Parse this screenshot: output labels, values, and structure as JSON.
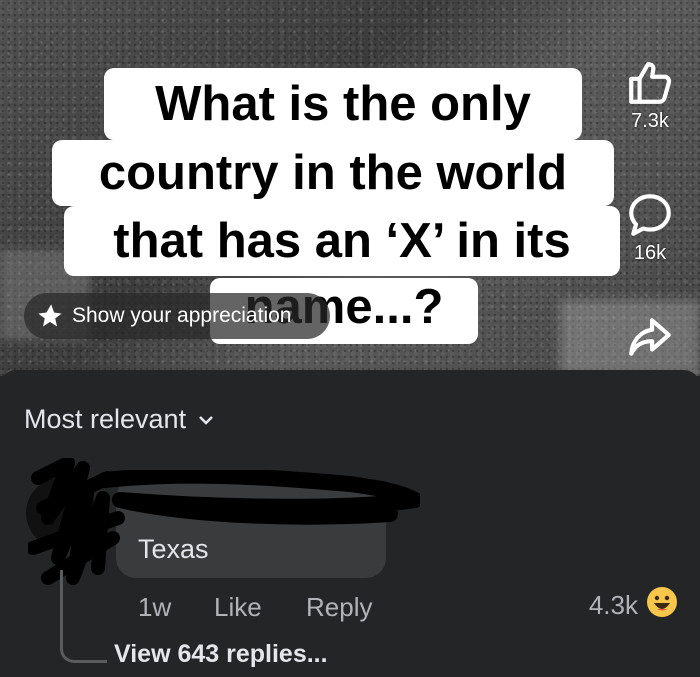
{
  "video": {
    "caption_lines": [
      "What is the only",
      "country in the world",
      "that has an ‘X’ in its",
      "name...?"
    ],
    "appreciation_label": "Show your appreciation",
    "actions": {
      "like_count": "7.3k",
      "comment_count": "16k",
      "like_icon": "thumbs-up-icon",
      "comment_icon": "speech-bubble-icon",
      "share_icon": "share-arrow-icon"
    }
  },
  "comments": {
    "sort_label": "Most relevant",
    "items": [
      {
        "text": "Texas",
        "time": "1w",
        "like_label": "Like",
        "reply_label": "Reply",
        "reaction_count": "4.3k",
        "reaction_emoji": "😀",
        "view_replies_label": "View 643 replies..."
      }
    ]
  },
  "colors": {
    "sheet_bg": "#242526",
    "bubble_bg": "#3a3b3c",
    "text_primary": "#e4e6eb",
    "text_secondary": "#b0b3b8"
  }
}
